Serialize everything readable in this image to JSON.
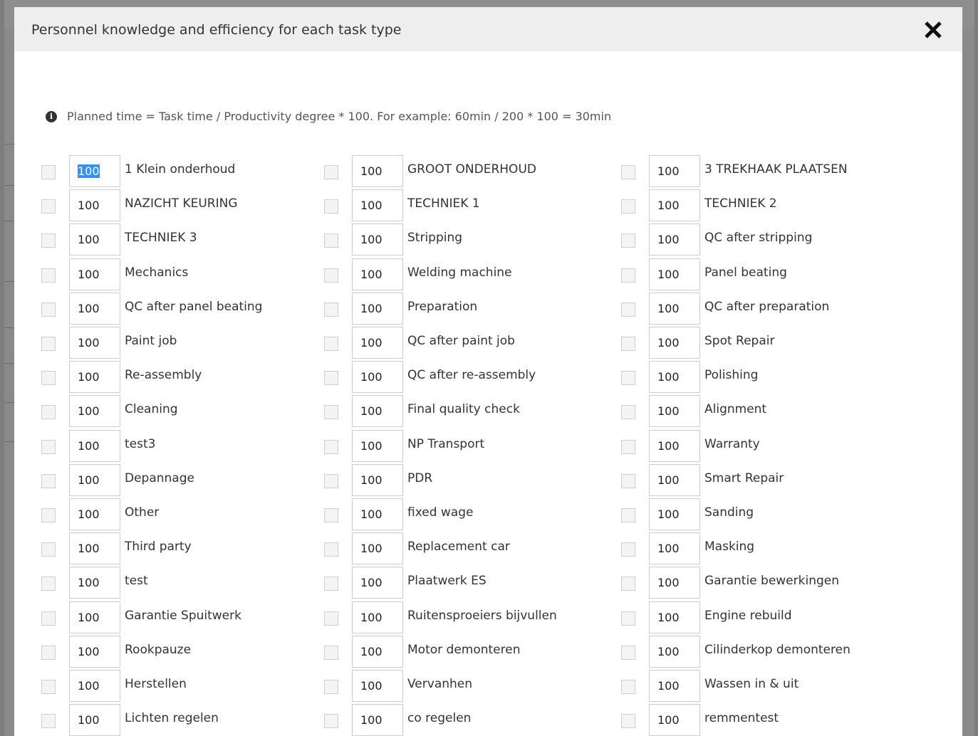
{
  "modal": {
    "title": "Personnel knowledge and efficiency for each task type",
    "close_icon": "close-icon",
    "info_icon": "info-icon",
    "info_text": "Planned time = Task time / Productivity degree * 100. For example: 60min / 200 * 100 = 30min"
  },
  "columns": [
    [
      {
        "value": "100",
        "label": "1 Klein onderhoud",
        "selected": true
      },
      {
        "value": "100",
        "label": "NAZICHT KEURING"
      },
      {
        "value": "100",
        "label": "TECHNIEK 3"
      },
      {
        "value": "100",
        "label": "Mechanics"
      },
      {
        "value": "100",
        "label": "QC after panel beating"
      },
      {
        "value": "100",
        "label": "Paint job"
      },
      {
        "value": "100",
        "label": "Re-assembly"
      },
      {
        "value": "100",
        "label": "Cleaning"
      },
      {
        "value": "100",
        "label": "test3"
      },
      {
        "value": "100",
        "label": "Depannage"
      },
      {
        "value": "100",
        "label": "Other"
      },
      {
        "value": "100",
        "label": "Third party"
      },
      {
        "value": "100",
        "label": "test"
      },
      {
        "value": "100",
        "label": "Garantie Spuitwerk"
      },
      {
        "value": "100",
        "label": "Rookpauze"
      },
      {
        "value": "100",
        "label": "Herstellen"
      },
      {
        "value": "100",
        "label": "Lichten regelen"
      }
    ],
    [
      {
        "value": "100",
        "label": "GROOT ONDERHOUD"
      },
      {
        "value": "100",
        "label": "TECHNIEK 1"
      },
      {
        "value": "100",
        "label": "Stripping"
      },
      {
        "value": "100",
        "label": "Welding machine"
      },
      {
        "value": "100",
        "label": "Preparation"
      },
      {
        "value": "100",
        "label": "QC after paint job"
      },
      {
        "value": "100",
        "label": "QC after re-assembly"
      },
      {
        "value": "100",
        "label": "Final quality check"
      },
      {
        "value": "100",
        "label": "NP Transport"
      },
      {
        "value": "100",
        "label": "PDR"
      },
      {
        "value": "100",
        "label": "fixed wage"
      },
      {
        "value": "100",
        "label": "Replacement car"
      },
      {
        "value": "100",
        "label": "Plaatwerk ES"
      },
      {
        "value": "100",
        "label": "Ruitensproeiers bijvullen"
      },
      {
        "value": "100",
        "label": "Motor demonteren"
      },
      {
        "value": "100",
        "label": "Vervanhen"
      },
      {
        "value": "100",
        "label": "co regelen"
      }
    ],
    [
      {
        "value": "100",
        "label": "3 TREKHAAK PLAATSEN"
      },
      {
        "value": "100",
        "label": "TECHNIEK 2"
      },
      {
        "value": "100",
        "label": "QC after stripping"
      },
      {
        "value": "100",
        "label": "Panel beating"
      },
      {
        "value": "100",
        "label": "QC after preparation"
      },
      {
        "value": "100",
        "label": "Spot Repair"
      },
      {
        "value": "100",
        "label": "Polishing"
      },
      {
        "value": "100",
        "label": "Alignment"
      },
      {
        "value": "100",
        "label": "Warranty"
      },
      {
        "value": "100",
        "label": "Smart Repair"
      },
      {
        "value": "100",
        "label": "Sanding"
      },
      {
        "value": "100",
        "label": "Masking"
      },
      {
        "value": "100",
        "label": "Garantie bewerkingen"
      },
      {
        "value": "100",
        "label": "Engine rebuild"
      },
      {
        "value": "100",
        "label": "Cilinderkop demonteren"
      },
      {
        "value": "100",
        "label": "Wassen in & uit"
      },
      {
        "value": "100",
        "label": "remmentest"
      }
    ]
  ]
}
